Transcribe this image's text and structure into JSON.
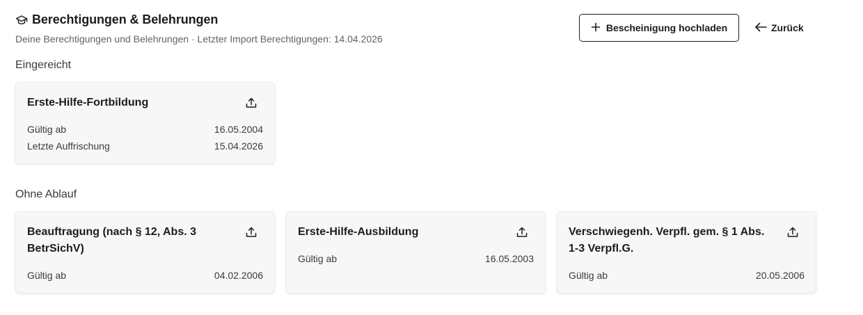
{
  "header": {
    "title": "Berechtigungen & Belehrungen",
    "title_icon": "graduation-cap-icon",
    "subtitle": "Deine Berechtigungen und Belehrungen · Letzter Import Berechtigungen: 14.04.2026"
  },
  "actions": {
    "upload_label": "Bescheinigung hochladen",
    "upload_icon": "plus-icon",
    "back_label": "Zurück",
    "back_icon": "arrow-left-icon"
  },
  "sections": {
    "submitted": {
      "heading": "Eingereicht",
      "cards": [
        {
          "title": "Erste-Hilfe-Fortbildung",
          "rows": [
            {
              "label": "Gültig ab",
              "value": "16.05.2004"
            },
            {
              "label": "Letzte Auffrischung",
              "value": "15.04.2026"
            }
          ]
        }
      ]
    },
    "no_expiry": {
      "heading": "Ohne Ablauf",
      "cards": [
        {
          "title": "Beauftragung (nach § 12, Abs. 3 BetrSichV)",
          "rows": [
            {
              "label": "Gültig ab",
              "value": "04.02.2006"
            }
          ]
        },
        {
          "title": "Erste-Hilfe-Ausbildung",
          "rows": [
            {
              "label": "Gültig ab",
              "value": "16.05.2003"
            }
          ]
        },
        {
          "title": "Verschwiegenh. Verpfl. gem. § 1 Abs. 1-3 Verpfl.G.",
          "rows": [
            {
              "label": "Gültig ab",
              "value": "20.05.2006"
            }
          ]
        }
      ]
    }
  },
  "colors": {
    "text": "#1c1c1e",
    "muted": "#5f6368",
    "card_bg": "#f7f7f7",
    "border": "#1c1c1e"
  }
}
